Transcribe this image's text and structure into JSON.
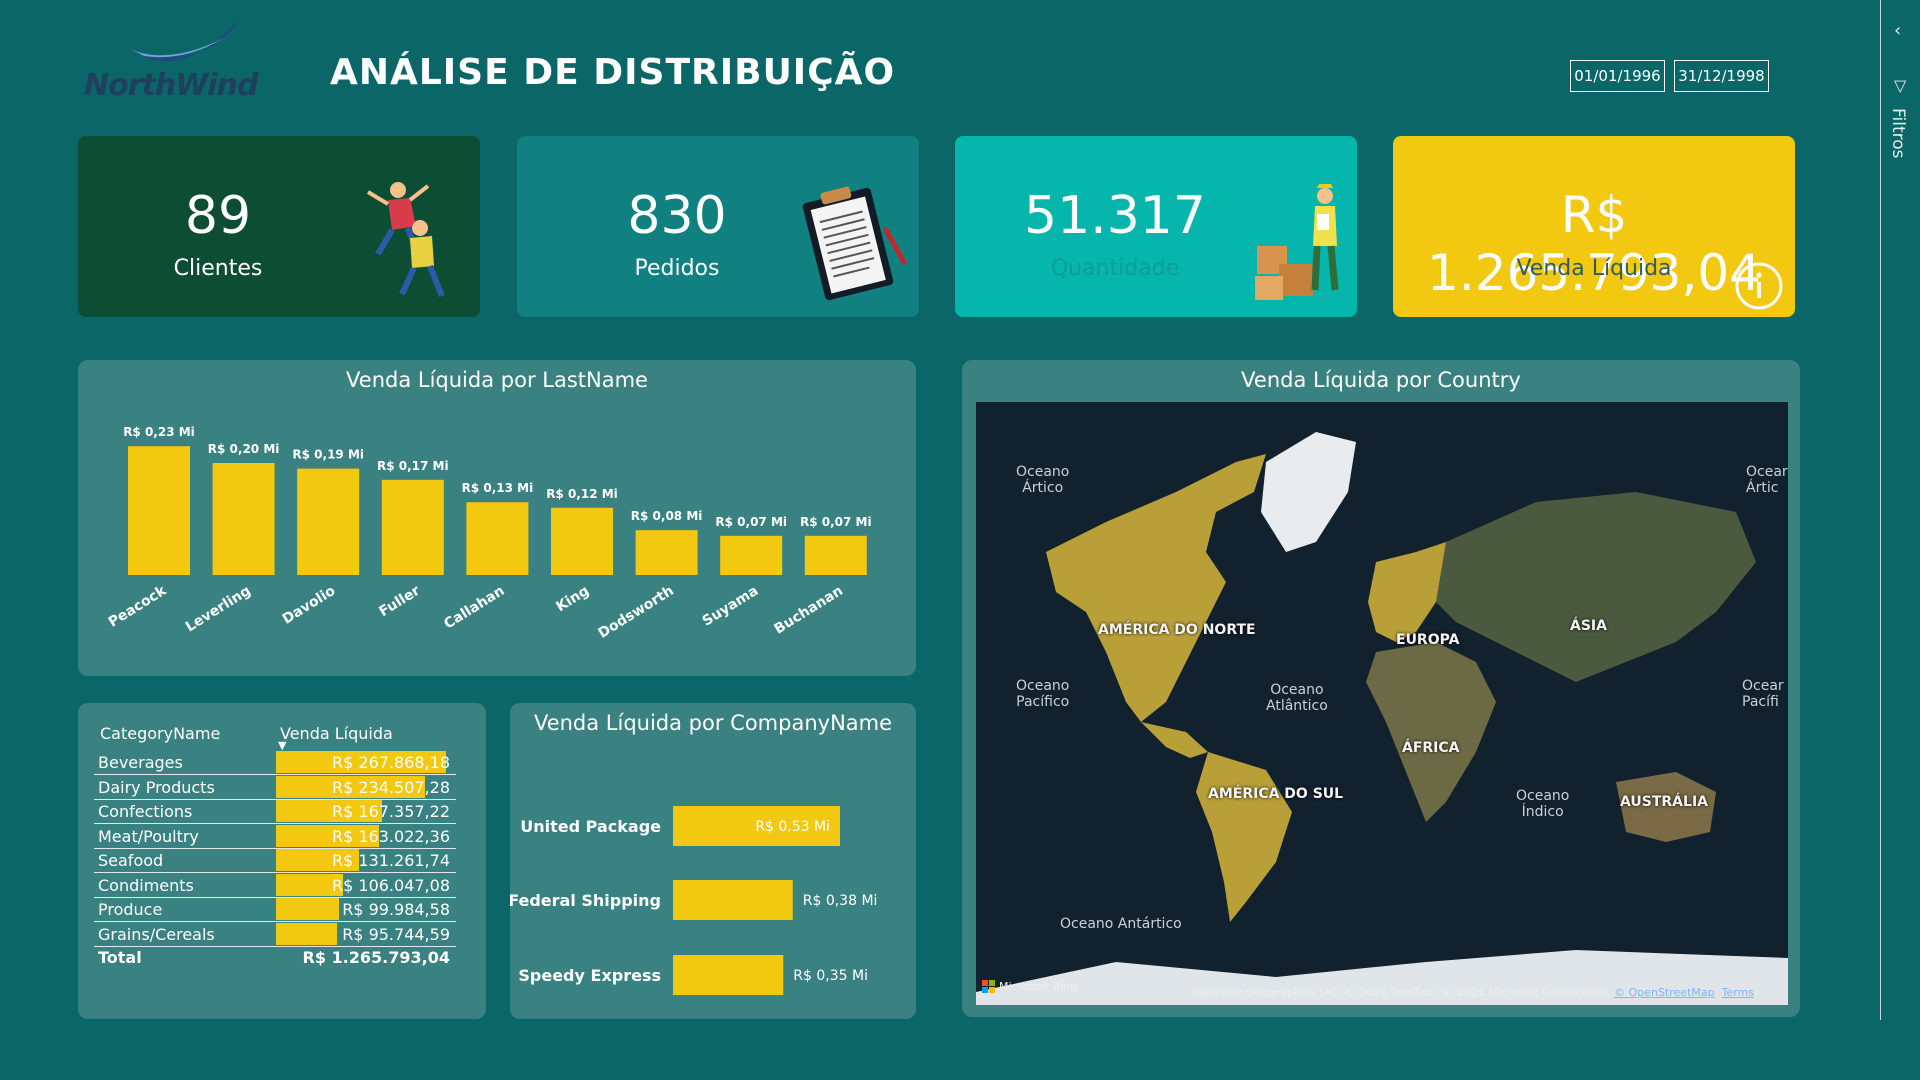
{
  "header": {
    "logo_text_1": "North",
    "logo_text_2": "Wind",
    "title": "ANÁLISE DE DISTRIBUIÇÃO",
    "date_start": "01/01/1996",
    "date_end": "31/12/1998",
    "filter_pane_label": "Filtros"
  },
  "kpis": [
    {
      "value": "89",
      "label": "Clientes",
      "icon": "people-jumping-icon"
    },
    {
      "value": "830",
      "label": "Pedidos",
      "icon": "clipboard-icon"
    },
    {
      "value": "51.317",
      "label": "Quantidade",
      "icon": "delivery-worker-boxes-icon"
    },
    {
      "value": "R$ 1.265.793,04",
      "label": "Venda Líquida",
      "icon": "info-icon"
    }
  ],
  "colors": {
    "background": "#0b6668",
    "panel": "#3a8282",
    "accent_yellow": "#f2c811",
    "kpi_dark_green": "#0d4d34",
    "kpi_teal": "#108080",
    "kpi_aqua": "#06b5ab"
  },
  "bar_panel": {
    "title": "Venda Líquida por LastName"
  },
  "map_panel": {
    "title": "Venda Líquida por Country",
    "continents": [
      "AMÉRICA DO NORTE",
      "EUROPA",
      "ÁSIA",
      "ÁFRICA",
      "AMÉRICA DO SUL",
      "AUSTRÁLIA"
    ],
    "oceans": [
      "Oceano\nÁrtico",
      "Oceano\nPacífico",
      "Oceano\nAtlântico",
      "Oceano\nÍndico",
      "Oceano Antártico",
      "Ocear\nÁrtic",
      "Ocear\nPacífi"
    ],
    "bing_label": "Microsoft Bing",
    "attribution": "Earthstar Geographics SIO, © 2021 TomTom, © 2021 Microsoft Corporation, ",
    "attribution_link": "© OpenStreetMap",
    "terms": "Terms"
  },
  "table_panel": {
    "col1": "CategoryName",
    "col2": "Venda Líquida",
    "rows": [
      {
        "name": "Beverages",
        "value": "R$ 267.868,18"
      },
      {
        "name": "Dairy Products",
        "value": "R$ 234.507,28"
      },
      {
        "name": "Confections",
        "value": "R$ 167.357,22"
      },
      {
        "name": "Meat/Poultry",
        "value": "R$ 163.022,36"
      },
      {
        "name": "Seafood",
        "value": "R$ 131.261,74"
      },
      {
        "name": "Condiments",
        "value": "R$ 106.047,08"
      },
      {
        "name": "Produce",
        "value": "R$ 99.984,58"
      },
      {
        "name": "Grains/Cereals",
        "value": "R$ 95.744,59"
      }
    ],
    "total_label": "Total",
    "total_value": "R$ 1.265.793,04"
  },
  "company_panel": {
    "title": "Venda Líquida por CompanyName"
  },
  "chart_data": [
    {
      "type": "bar",
      "title": "Venda Líquida por LastName",
      "categories": [
        "Peacock",
        "Leverling",
        "Davolio",
        "Fuller",
        "Callahan",
        "King",
        "Dodsworth",
        "Suyama",
        "Buchanan"
      ],
      "values": [
        0.23,
        0.2,
        0.19,
        0.17,
        0.13,
        0.12,
        0.08,
        0.07,
        0.07
      ],
      "data_labels": [
        "R$ 0,23 Mi",
        "R$ 0,20 Mi",
        "R$ 0,19 Mi",
        "R$ 0,17 Mi",
        "R$ 0,13 Mi",
        "R$ 0,12 Mi",
        "R$ 0,08 Mi",
        "R$ 0,07 Mi",
        "R$ 0,07 Mi"
      ],
      "color": "#f2c811",
      "ylim": [
        0,
        0.25
      ]
    },
    {
      "type": "bar",
      "orientation": "horizontal",
      "title": "Venda Líquida por CompanyName",
      "categories": [
        "United Package",
        "Federal Shipping",
        "Speedy Express"
      ],
      "values": [
        0.53,
        0.38,
        0.35
      ],
      "data_labels": [
        "R$ 0,53 Mi",
        "R$ 0,38 Mi",
        "R$ 0,35 Mi"
      ],
      "color": "#f2c811",
      "xlim": [
        0,
        0.53
      ]
    },
    {
      "type": "table",
      "title": "CategoryName / Venda Líquida",
      "categories": [
        "Beverages",
        "Dairy Products",
        "Confections",
        "Meat/Poultry",
        "Seafood",
        "Condiments",
        "Produce",
        "Grains/Cereals"
      ],
      "values": [
        267868.18,
        234507.28,
        167357.22,
        163022.36,
        131261.74,
        106047.08,
        99984.58,
        95744.59
      ]
    }
  ]
}
